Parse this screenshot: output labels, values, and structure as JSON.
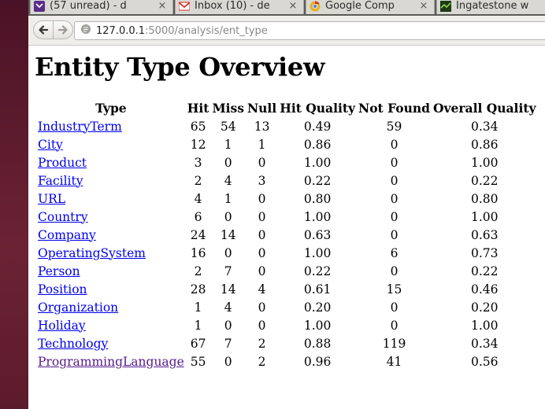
{
  "browser": {
    "tabs": [
      {
        "label": "(57 unread) - d",
        "icon": "yahoo-mail-icon",
        "icon_color": "#5b2d8a"
      },
      {
        "label": "Inbox (10) - de",
        "icon": "gmail-icon",
        "icon_color": "#d93025"
      },
      {
        "label": "Google Comp",
        "icon": "chrome-icon",
        "icon_color": "#e8b021"
      },
      {
        "label": "Ingatestone w",
        "icon": "site-icon",
        "icon_color": "#3a7d2a"
      }
    ],
    "tab_close_glyph": "×",
    "url": {
      "host": "127.0.0.1",
      "path": ":5000/analysis/ent_type"
    }
  },
  "page": {
    "title": "Entity Type Overview",
    "columns": [
      "Type",
      "Hit",
      "Miss",
      "Null",
      "Hit Quality",
      "Not Found",
      "Overall Quality"
    ],
    "rows": [
      {
        "type": "IndustryTerm",
        "hit": "65",
        "miss": "54",
        "null": "13",
        "hit_quality": "0.49",
        "not_found": "59",
        "overall_quality": "0.34"
      },
      {
        "type": "City",
        "hit": "12",
        "miss": "1",
        "null": "1",
        "hit_quality": "0.86",
        "not_found": "0",
        "overall_quality": "0.86"
      },
      {
        "type": "Product",
        "hit": "3",
        "miss": "0",
        "null": "0",
        "hit_quality": "1.00",
        "not_found": "0",
        "overall_quality": "1.00"
      },
      {
        "type": "Facility",
        "hit": "2",
        "miss": "4",
        "null": "3",
        "hit_quality": "0.22",
        "not_found": "0",
        "overall_quality": "0.22"
      },
      {
        "type": "URL",
        "hit": "4",
        "miss": "1",
        "null": "0",
        "hit_quality": "0.80",
        "not_found": "0",
        "overall_quality": "0.80"
      },
      {
        "type": "Country",
        "hit": "6",
        "miss": "0",
        "null": "0",
        "hit_quality": "1.00",
        "not_found": "0",
        "overall_quality": "1.00"
      },
      {
        "type": "Company",
        "hit": "24",
        "miss": "14",
        "null": "0",
        "hit_quality": "0.63",
        "not_found": "0",
        "overall_quality": "0.63"
      },
      {
        "type": "OperatingSystem",
        "hit": "16",
        "miss": "0",
        "null": "0",
        "hit_quality": "1.00",
        "not_found": "6",
        "overall_quality": "0.73"
      },
      {
        "type": "Person",
        "hit": "2",
        "miss": "7",
        "null": "0",
        "hit_quality": "0.22",
        "not_found": "0",
        "overall_quality": "0.22"
      },
      {
        "type": "Position",
        "hit": "28",
        "miss": "14",
        "null": "4",
        "hit_quality": "0.61",
        "not_found": "15",
        "overall_quality": "0.46"
      },
      {
        "type": "Organization",
        "hit": "1",
        "miss": "4",
        "null": "0",
        "hit_quality": "0.20",
        "not_found": "0",
        "overall_quality": "0.20"
      },
      {
        "type": "Holiday",
        "hit": "1",
        "miss": "0",
        "null": "0",
        "hit_quality": "1.00",
        "not_found": "0",
        "overall_quality": "1.00"
      },
      {
        "type": "Technology",
        "hit": "67",
        "miss": "7",
        "null": "2",
        "hit_quality": "0.88",
        "not_found": "119",
        "overall_quality": "0.34"
      },
      {
        "type": "ProgrammingLanguage",
        "hit": "55",
        "miss": "0",
        "null": "2",
        "hit_quality": "0.96",
        "not_found": "41",
        "overall_quality": "0.56",
        "visited": true
      }
    ]
  },
  "colors": {
    "link": "#0000ee",
    "visited_link": "#551a8b"
  }
}
